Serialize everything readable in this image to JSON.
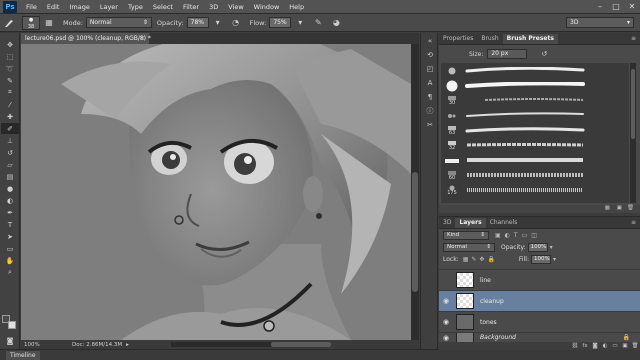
{
  "app": {
    "logo": "Ps"
  },
  "menu": [
    "File",
    "Edit",
    "Image",
    "Layer",
    "Type",
    "Select",
    "Filter",
    "3D",
    "View",
    "Window",
    "Help"
  ],
  "window_controls": [
    "–",
    "□",
    "✕"
  ],
  "options": {
    "brush_size": "38",
    "mode_label": "Mode:",
    "mode_value": "Normal",
    "opacity_label": "Opacity:",
    "opacity_value": "78%",
    "flow_label": "Flow:",
    "flow_value": "75%",
    "workspace": "3D"
  },
  "toolbox": {
    "tools": [
      "move",
      "marquee",
      "lasso",
      "quick-select",
      "crop",
      "eyedropper",
      "heal",
      "brush",
      "clone-stamp",
      "history-brush",
      "eraser",
      "gradient",
      "blur",
      "dodge",
      "pen",
      "type",
      "path-select",
      "shape",
      "hand",
      "zoom"
    ],
    "active_tool": "brush"
  },
  "document": {
    "tab_title": "lecture06.psd @ 100% (cleanup, RGB/8) *",
    "close": "×"
  },
  "status": {
    "zoom": "100%",
    "doc_info": "Doc: 2.86M/14.3M"
  },
  "timeline": {
    "label": "Timeline"
  },
  "brush_panel": {
    "tabs": [
      "Properties",
      "Brush",
      "Brush Presets"
    ],
    "active_tab": "Brush Presets",
    "size_label": "Size:",
    "size_value": "20 px",
    "brush_numbers": [
      "",
      "",
      "30",
      "",
      "63",
      "32",
      "",
      "60",
      "175",
      "",
      ""
    ]
  },
  "layers_panel": {
    "tabs": [
      "3D",
      "Layers",
      "Channels"
    ],
    "active_tab": "Layers",
    "kind_label": "Kind",
    "blend_mode": "Normal",
    "opacity_label": "Opacity:",
    "opacity_value": "100%",
    "lock_label": "Lock:",
    "fill_label": "Fill:",
    "fill_value": "100%",
    "layers": [
      {
        "name": "line",
        "visible": false,
        "selected": false,
        "italic": false
      },
      {
        "name": "cleanup",
        "visible": true,
        "selected": true,
        "italic": false
      },
      {
        "name": "tones",
        "visible": true,
        "selected": false,
        "italic": false
      },
      {
        "name": "Background",
        "visible": true,
        "selected": false,
        "italic": true
      }
    ]
  }
}
